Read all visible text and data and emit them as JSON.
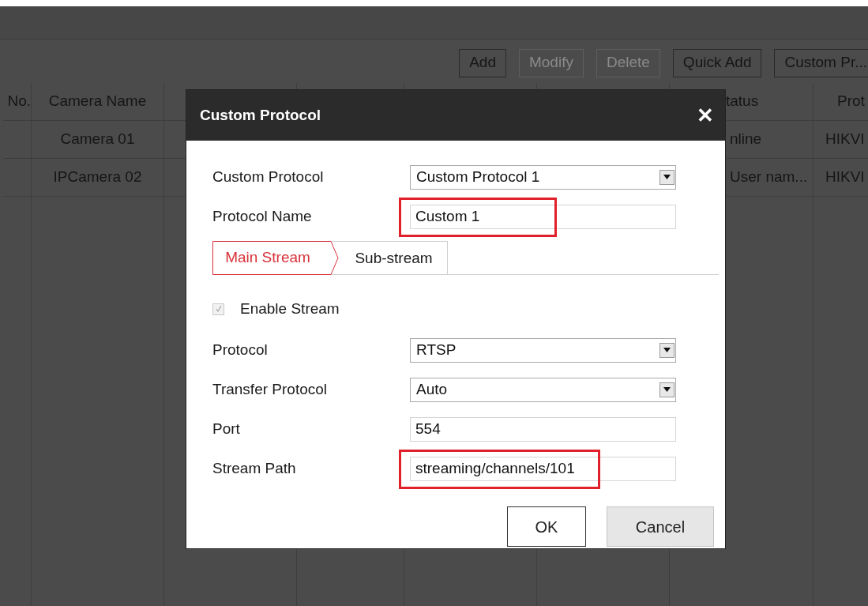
{
  "toolbar": {
    "buttons": [
      {
        "label": "Add",
        "disabled": false
      },
      {
        "label": "Modify",
        "disabled": true
      },
      {
        "label": "Delete",
        "disabled": true
      },
      {
        "label": "Quick Add",
        "disabled": false
      },
      {
        "label": "Custom Pr...",
        "disabled": false
      }
    ]
  },
  "table": {
    "columns": [
      "No.",
      "Camera Name",
      "",
      "",
      "",
      "",
      "tatus",
      "Prot"
    ],
    "rows": [
      [
        "",
        "Camera 01",
        "",
        "",
        "",
        "",
        "nline",
        "HIKVI"
      ],
      [
        "",
        "IPCamera 02",
        "",
        "",
        "",
        "",
        "User nam...",
        "HIKVI"
      ]
    ]
  },
  "dialog": {
    "title": "Custom Protocol",
    "close": "✕",
    "fields_top": [
      {
        "kind": "select",
        "label": "Custom Protocol",
        "value": "Custom Protocol 1",
        "highlighted": false
      },
      {
        "kind": "text",
        "label": "Protocol Name",
        "value": "Custom 1",
        "highlighted": true
      }
    ],
    "tabs": [
      {
        "label": "Main Stream",
        "selected": true
      },
      {
        "label": "Sub-stream",
        "selected": false
      }
    ],
    "enable_stream": {
      "label": "Enable Stream",
      "checked": true,
      "disabled": true
    },
    "fields": [
      {
        "kind": "select",
        "label": "Protocol",
        "value": "RTSP",
        "highlighted": false
      },
      {
        "kind": "select",
        "label": "Transfer Protocol",
        "value": "Auto",
        "highlighted": false
      },
      {
        "kind": "text",
        "label": "Port",
        "value": "554",
        "highlighted": false
      },
      {
        "kind": "text",
        "label": "Stream Path",
        "value": "streaming/channels/101",
        "highlighted": true
      }
    ],
    "buttons": [
      "OK",
      "Cancel"
    ]
  }
}
